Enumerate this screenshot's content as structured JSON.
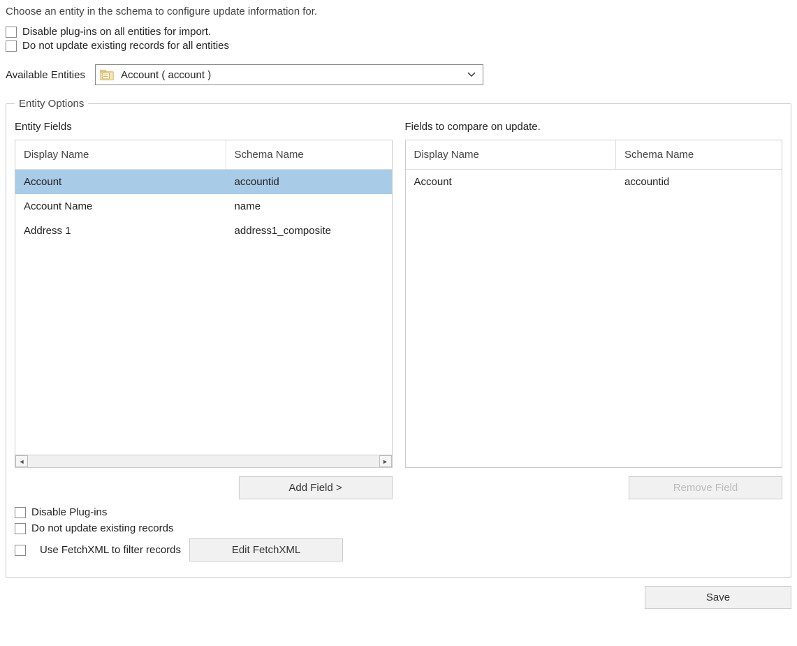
{
  "intro": "Choose an entity in the schema to configure update information for.",
  "topOptions": {
    "disablePluginsAll": "Disable plug-ins on all entities for import.",
    "noUpdateAll": "Do not update existing records for all entities"
  },
  "availableEntities": {
    "label": "Available Entities",
    "selected": "Account  ( account )"
  },
  "entityOptions": {
    "legend": "Entity Options",
    "leftTitle": "Entity Fields",
    "rightTitle": "Fields to compare on update.",
    "headers": {
      "display": "Display Name",
      "schema": "Schema Name"
    },
    "leftRows": [
      {
        "display": "Account",
        "schema": "accountid",
        "selected": true
      },
      {
        "display": "Account Name",
        "schema": "name",
        "selected": false
      },
      {
        "display": "Address 1",
        "schema": "address1_composite",
        "selected": false
      }
    ],
    "rightRows": [
      {
        "display": "Account",
        "schema": "accountid",
        "selected": false
      }
    ],
    "addFieldLabel": "Add Field >",
    "removeFieldLabel": "Remove Field",
    "removeFieldDisabled": true,
    "bottom": {
      "disablePlugins": "Disable Plug-ins",
      "noUpdateExisting": "Do not update existing records",
      "useFetchXml": "Use FetchXML to filter records",
      "editFetchXml": "Edit FetchXML"
    }
  },
  "footer": {
    "save": "Save"
  }
}
